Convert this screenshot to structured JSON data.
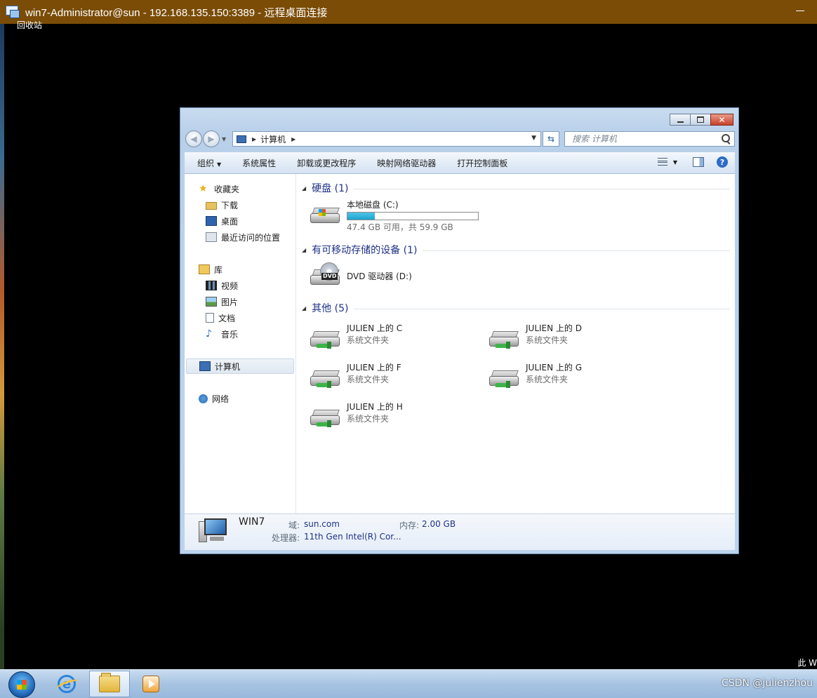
{
  "rdp": {
    "title": "win7-Administrator@sun - 192.168.135.150:3389 - 远程桌面连接"
  },
  "desktop": {
    "recycle_bin_label": "回收站",
    "corner_text": "此 W",
    "watermark": "CSDN @julienzhou"
  },
  "explorer": {
    "address": {
      "crumbs": [
        "计算机"
      ]
    },
    "search": {
      "placeholder": "搜索 计算机"
    },
    "toolbar": {
      "organize": "组织",
      "system_properties": "系统属性",
      "uninstall": "卸载或更改程序",
      "map_drive": "映射网络驱动器",
      "control_panel": "打开控制面板"
    },
    "nav": {
      "favorites": "收藏夹",
      "downloads": "下载",
      "desktop": "桌面",
      "recent": "最近访问的位置",
      "libraries": "库",
      "videos": "视频",
      "pictures": "图片",
      "documents": "文档",
      "music": "音乐",
      "computer": "计算机",
      "network": "网络"
    },
    "groups": {
      "hard_disks": "硬盘 (1)",
      "removable": "有可移动存储的设备 (1)",
      "other": "其他 (5)"
    },
    "local_disk": {
      "name": "本地磁盘 (C:)",
      "space": "47.4 GB 可用，共 59.9 GB",
      "used_fraction": 0.209
    },
    "dvd": {
      "name": "DVD 驱动器 (D:)"
    },
    "other_items": [
      {
        "name": "JULIEN 上的 C",
        "type": "系统文件夹"
      },
      {
        "name": "JULIEN 上的 D",
        "type": "系统文件夹"
      },
      {
        "name": "JULIEN 上的 F",
        "type": "系统文件夹"
      },
      {
        "name": "JULIEN 上的 G",
        "type": "系统文件夹"
      },
      {
        "name": "JULIEN 上的 H",
        "type": "系统文件夹"
      }
    ],
    "details": {
      "name": "WIN7",
      "domain_label": "域:",
      "domain": "sun.com",
      "memory_label": "内存:",
      "memory": "2.00 GB",
      "cpu_label": "处理器:",
      "cpu": "11th Gen Intel(R) Cor..."
    }
  },
  "colors": {
    "rdp_titlebar": "#7a4c06",
    "group_header": "#1e3287",
    "capacity_fill": "#1ea4d0"
  }
}
